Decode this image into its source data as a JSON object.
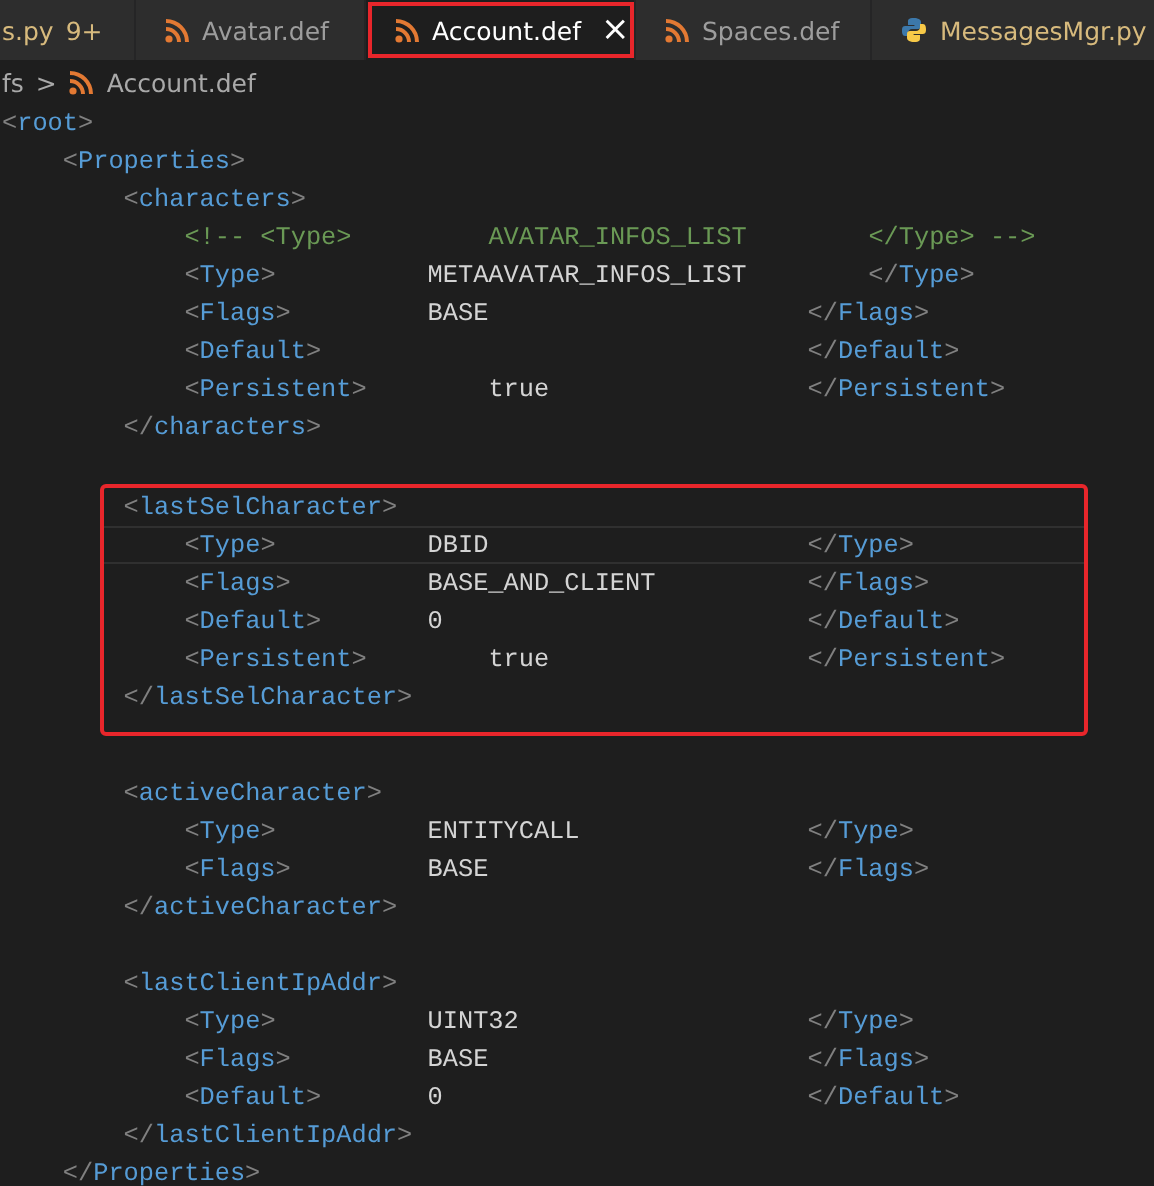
{
  "tabs": [
    {
      "label": "s.py",
      "problems": "9+",
      "selected": false,
      "modified": true,
      "annotated": false
    },
    {
      "label": "Avatar.def",
      "kind": "rss",
      "selected": false,
      "modified": false,
      "annotated": false
    },
    {
      "label": "Account.def",
      "kind": "rss",
      "selected": true,
      "close_glyph": "×",
      "modified": false,
      "annotated": true
    },
    {
      "label": "Spaces.def",
      "kind": "rss",
      "selected": false,
      "modified": false,
      "annotated": false
    },
    {
      "label": "MessagesMgr.py",
      "kind": "python",
      "selected": false,
      "modified": true,
      "annotated": false
    }
  ],
  "breadcrumbs": {
    "folder": "fs",
    "separator": ">",
    "file": "Account.def"
  },
  "code": {
    "open": "<root>",
    "children": [
      {
        "open": "<Properties>",
        "close": "</Properties>",
        "children": [
          {
            "open": "<characters>",
            "close": "</characters>",
            "children": [
              {
                "kind": "comment",
                "open": "<!-- <Type>",
                "value": "AVATAR_INFOS_LIST",
                "close": "</Type> -->"
              },
              {
                "open": "<Type>",
                "value": "METAAVATAR_INFOS_LIST",
                "close": "</Type>"
              },
              {
                "open": "<Flags>",
                "value": "BASE",
                "close": "</Flags>"
              },
              {
                "open": "<Default>",
                "close": "</Default>"
              },
              {
                "open": "<Persistent>",
                "value": "true",
                "close": "</Persistent>"
              }
            ]
          },
          {
            "open": "<lastSelCharacter>",
            "close": "</lastSelCharacter>",
            "blank_before": true,
            "annotated": true,
            "children": [
              {
                "open": "<Type>",
                "value": "DBID",
                "close": "</Type>",
                "current": true
              },
              {
                "open": "<Flags>",
                "value": "BASE_AND_CLIENT",
                "close": "</Flags>",
                "current": false
              },
              {
                "open": "<Default>",
                "value": "0",
                "close": "</Default>",
                "current": false
              },
              {
                "open": "<Persistent>",
                "value": "true",
                "close": "</Persistent>",
                "current": false
              }
            ]
          },
          {
            "open": "<activeCharacter>",
            "close": "</activeCharacter>",
            "blank_before": true,
            "annotated": false,
            "children": [
              {
                "open": "<Type>",
                "value": "ENTITYCALL",
                "close": "</Type>"
              },
              {
                "open": "<Flags>",
                "value": "BASE",
                "close": "</Flags>"
              }
            ]
          },
          {
            "open": "<lastClientIpAddr>",
            "close": "</lastClientIpAddr>",
            "blank_before": true,
            "annotated": false,
            "children": [
              {
                "open": "<Type>",
                "value": "UINT32",
                "close": "</Type>"
              },
              {
                "open": "<Flags>",
                "value": "BASE",
                "close": "</Flags>"
              },
              {
                "open": "<Default>",
                "value": "0",
                "close": "</Default>"
              }
            ]
          }
        ]
      }
    ]
  }
}
